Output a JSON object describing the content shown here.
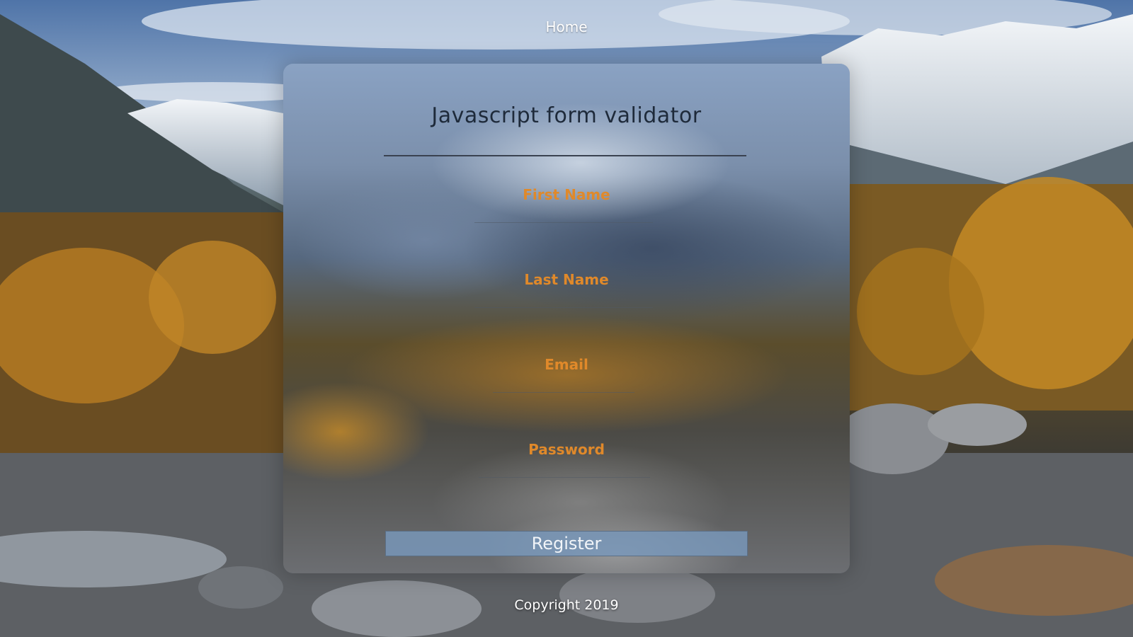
{
  "nav": {
    "home_label": "Home"
  },
  "form": {
    "title": "Javascript form validator",
    "fields": [
      {
        "placeholder": "First Name",
        "value": ""
      },
      {
        "placeholder": "Last Name",
        "value": ""
      },
      {
        "placeholder": "Email",
        "value": ""
      },
      {
        "placeholder": "Password",
        "value": ""
      }
    ],
    "submit_label": "Register"
  },
  "footer": {
    "text": "Copyright 2019"
  },
  "colors": {
    "accent": "#e0892a",
    "title": "#1e2a3a",
    "button": "#7896b9"
  },
  "background": {
    "subject": "mountain-valley-photo"
  }
}
